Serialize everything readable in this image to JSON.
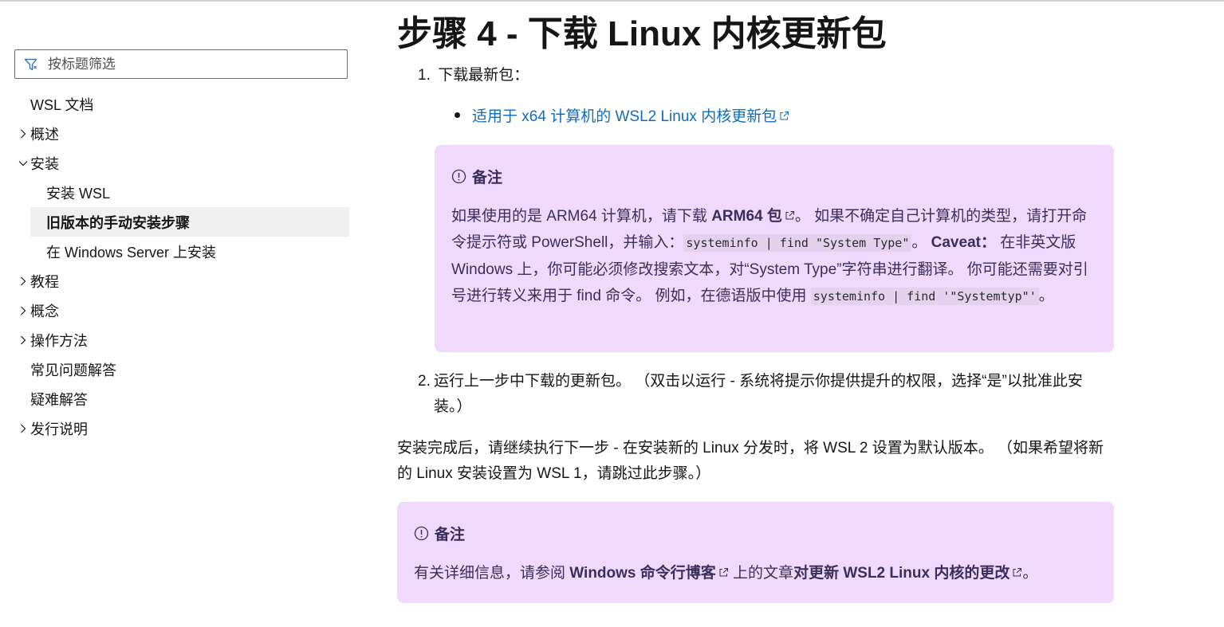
{
  "sidebar": {
    "filter_placeholder": "按标题筛选",
    "items": [
      {
        "label": "WSL 文档",
        "level": 0,
        "chevron": "none"
      },
      {
        "label": "概述",
        "level": 0,
        "chevron": "right"
      },
      {
        "label": "安装",
        "level": 0,
        "chevron": "down"
      },
      {
        "label": "安装 WSL",
        "level": 1,
        "chevron": "none"
      },
      {
        "label": "旧版本的手动安装步骤",
        "level": 1,
        "chevron": "none",
        "active": true
      },
      {
        "label": "在 Windows Server 上安装",
        "level": 1,
        "chevron": "none"
      },
      {
        "label": "教程",
        "level": 0,
        "chevron": "right"
      },
      {
        "label": "概念",
        "level": 0,
        "chevron": "right"
      },
      {
        "label": "操作方法",
        "level": 0,
        "chevron": "right"
      },
      {
        "label": "常见问题解答",
        "level": 0,
        "chevron": "none"
      },
      {
        "label": "疑难解答",
        "level": 0,
        "chevron": "none"
      },
      {
        "label": "发行说明",
        "level": 0,
        "chevron": "right"
      }
    ]
  },
  "main": {
    "title": "步骤 4 - 下载 Linux 内核更新包",
    "step1": {
      "number": "1.",
      "text": "下载最新包："
    },
    "bullet_link": "适用于 x64 计算机的 WSL2 Linux 内核更新包",
    "note1": {
      "title": "备注",
      "t1": "如果使用的是 ARM64 计算机，请下载 ",
      "link": "ARM64 包",
      "t2": "。 如果不确定自己计算机的类型，请打开命令提示符或 PowerShell，并输入：",
      "code1": "systeminfo | find \"System Type\"",
      "t3": "。 ",
      "bold": "Caveat：",
      "t4": " 在非英文版 Windows 上，你可能必须修改搜索文本，对“System Type”字符串进行翻译。 你可能还需要对引号进行转义来用于 find 命令。 例如，在德语版中使用 ",
      "code2": "systeminfo | find '\"Systemtyp\"'",
      "t5": "。"
    },
    "step2": {
      "number": "2.",
      "text": "运行上一步中下载的更新包。 （双击以运行 - 系统将提示你提供提升的权限，选择“是”以批准此安装。）"
    },
    "after_text": "安装完成后，请继续执行下一步 - 在安装新的 Linux 分发时，将 WSL 2 设置为默认版本。 （如果希望将新的 Linux 安装设置为 WSL 1，请跳过此步骤。）",
    "note2": {
      "title": "备注",
      "t1": "有关详细信息，请参阅 ",
      "link1": "Windows 命令行博客",
      "t2": " 上的文章",
      "link2": "对更新 WSL2 Linux 内核的更改",
      "t3": "。"
    }
  },
  "colors": {
    "link": "#0f6cbd",
    "note_bg": "#efd9fd",
    "note_text": "#3b2e58",
    "active_bg": "#f0f0f0"
  }
}
